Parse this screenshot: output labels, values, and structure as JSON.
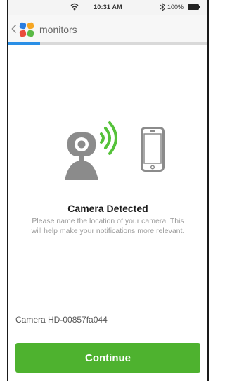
{
  "status_bar": {
    "time": "10:31 AM",
    "battery": "100%",
    "icons": [
      "wifi-icon",
      "bluetooth-icon",
      "battery-icon"
    ]
  },
  "nav": {
    "title": "monitors",
    "back_icon": "chevron-left-icon",
    "logo_icon": "app-logo-icon",
    "progress_fraction": 0.16,
    "progress_color": "#2a8fe6"
  },
  "illustration": {
    "icons": [
      "camera-icon",
      "wireless-signal-icon",
      "phone-icon"
    ],
    "signal_color": "#55c23a"
  },
  "content": {
    "heading": "Camera Detected",
    "description": "Please name the location of your camera. This will help make your notifications more relevant."
  },
  "form": {
    "camera_name_value": "Camera HD-00857fa044",
    "continue_label": "Continue",
    "button_color": "#4eb22f"
  }
}
